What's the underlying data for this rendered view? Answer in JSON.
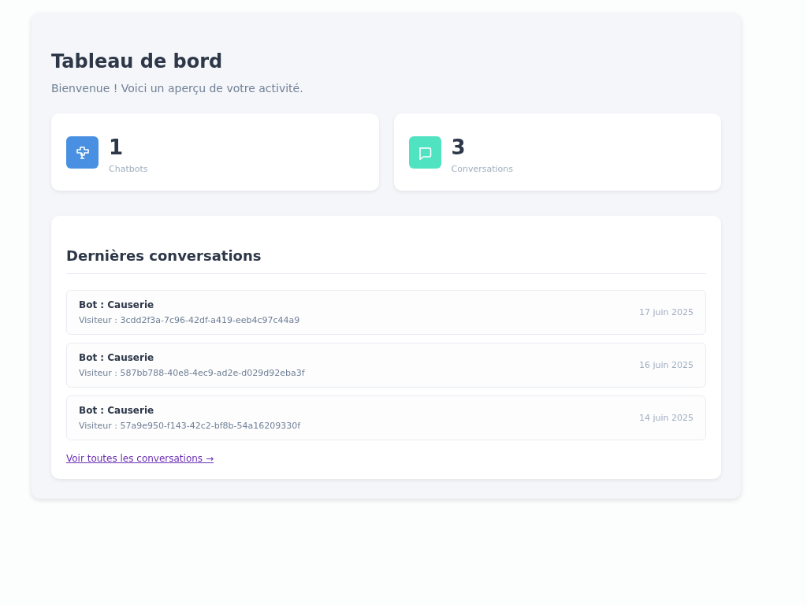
{
  "header": {
    "title": "Tableau de bord",
    "subtitle": "Bienvenue ! Voici un aperçu de votre activité."
  },
  "stats": [
    {
      "kind": "bot",
      "color": "#4a90e2",
      "value": "1",
      "label": "Chatbots"
    },
    {
      "kind": "chat",
      "color": "#50e3c2",
      "value": "3",
      "label": "Conversations"
    }
  ],
  "recent": {
    "title": "Dernières conversations",
    "items": [
      {
        "bot": "Bot : Causerie",
        "visitor": "Visiteur : 3cdd2f3a-7c96-42df-a419-eeb4c97c44a9",
        "date": "17 juin 2025"
      },
      {
        "bot": "Bot : Causerie",
        "visitor": "Visiteur : 587bb788-40e8-4ec9-ad2e-d029d92eba3f",
        "date": "16 juin 2025"
      },
      {
        "bot": "Bot : Causerie",
        "visitor": "Visiteur : 57a9e950-f143-42c2-bf8b-54a16209330f",
        "date": "14 juin 2025"
      }
    ],
    "link": "Voir toutes les conversations →"
  }
}
